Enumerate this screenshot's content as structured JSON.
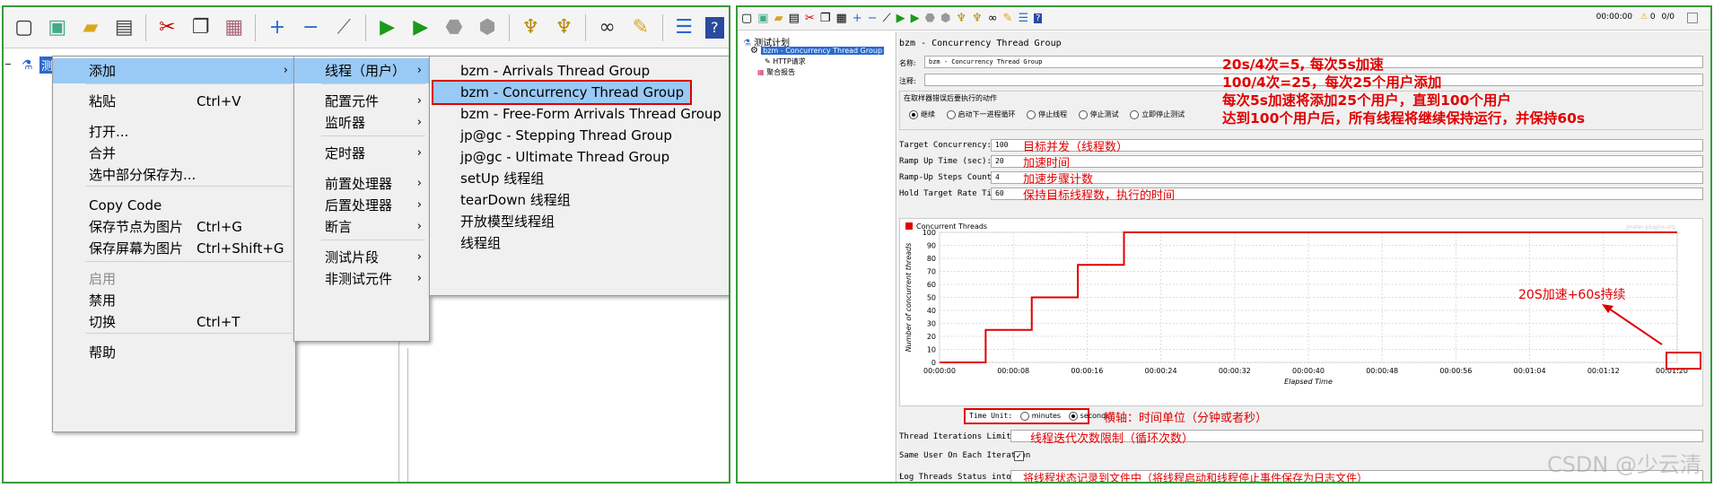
{
  "left": {
    "tree_root": "测",
    "context_menu": [
      {
        "label": "添加",
        "arrow": true
      },
      {
        "label": "粘贴",
        "shortcut": "Ctrl+V"
      },
      {
        "label": "打开..."
      },
      {
        "label": "合并"
      },
      {
        "label": "选中部分保存为..."
      },
      {
        "label": "Copy Code"
      },
      {
        "label": "保存节点为图片",
        "shortcut": "Ctrl+G"
      },
      {
        "label": "保存屏幕为图片",
        "shortcut": "Ctrl+Shift+G"
      },
      {
        "label": "启用",
        "disabled": true
      },
      {
        "label": "禁用"
      },
      {
        "label": "切换",
        "shortcut": "Ctrl+T"
      },
      {
        "label": "帮助"
      }
    ],
    "add_submenu": [
      "线程（用户）",
      "配置元件",
      "监听器",
      "定时器",
      "前置处理器",
      "后置处理器",
      "断言",
      "测试片段",
      "非测试元件"
    ],
    "thread_submenu": [
      "bzm - Arrivals Thread Group",
      "bzm - Concurrency Thread Group",
      "bzm - Free-Form Arrivals Thread Group",
      "jp@gc - Stepping Thread Group",
      "jp@gc - Ultimate Thread Group",
      "setUp 线程组",
      "tearDown 线程组",
      "开放模型线程组",
      "线程组"
    ]
  },
  "right": {
    "status": {
      "time": "00:00:00",
      "warnings": "0",
      "threads": "0/0"
    },
    "tree": {
      "plan": "测试计划",
      "group": "bzm - Concurrency Thread Group",
      "http": "HTTP请求",
      "report": "聚合报告"
    },
    "title": "bzm - Concurrency Thread Group",
    "name_label": "名称:",
    "name_value": "bzm - Concurrency Thread Group",
    "comment_label": "注释:",
    "error_title": "在取样器错误后要执行的动作",
    "error_options": [
      "继续",
      "启动下一进程循环",
      "停止线程",
      "停止测试",
      "立即停止测试"
    ],
    "fields": [
      {
        "label": "Target Concurrency:",
        "value": "100",
        "note": "目标并发（线程数）"
      },
      {
        "label": "Ramp Up Time (sec):",
        "value": "20",
        "note": "加速时间"
      },
      {
        "label": "Ramp-Up Steps Count:",
        "value": "4",
        "note": "加速步骤计数"
      },
      {
        "label": "Hold Target Rate Time (sec):",
        "value": "60",
        "note": "保持目标线程数，执行的时间"
      }
    ],
    "notes_top": [
      "20s/4次=5, 每次5s加速",
      "100/4次=25，每次25个用户添加",
      "每次5s加速将添加25个用户，直到100个用户",
      "达到100个用户后，所有线程将继续保持运行，并保持60s"
    ],
    "time_unit_label": "Time Unit:",
    "time_units": [
      "minutes",
      "seconds"
    ],
    "time_unit_note": "横轴：时间单位（分钟或者秒）",
    "iter_label": "Thread Iterations Limit:",
    "iter_note": "线程迭代次数限制（循环次数）",
    "same_user_label": "Same User On Each Iteration",
    "log_label": "Log Threads Status into File:",
    "log_note": "将线程状态记录到文件中（将线程启动和线程停止事件保存为日志文件）",
    "chart_note": "20S加速+60s持续",
    "watermark": "CSDN @少云清",
    "chart_watermark": "jmeter-plugins.org"
  },
  "chart_data": {
    "type": "line",
    "series": [
      {
        "name": "Concurrent Threads",
        "x": [
          0,
          5,
          5,
          10,
          10,
          15,
          15,
          20,
          20,
          80
        ],
        "y": [
          0,
          0,
          25,
          25,
          50,
          50,
          75,
          75,
          100,
          100
        ]
      }
    ],
    "xticks": [
      "00:00:00",
      "00:00:08",
      "00:00:16",
      "00:00:24",
      "00:00:32",
      "00:00:40",
      "00:00:48",
      "00:00:56",
      "00:01:04",
      "00:01:12",
      "00:01:20"
    ],
    "yticks": [
      0,
      10,
      20,
      30,
      40,
      50,
      60,
      70,
      80,
      90,
      100
    ],
    "xlabel": "Elapsed Time",
    "ylabel": "Number of concurrent threads",
    "xlim": [
      0,
      80
    ],
    "ylim": [
      0,
      100
    ],
    "grid": true,
    "legend": "top-left",
    "color": "#e00000"
  }
}
